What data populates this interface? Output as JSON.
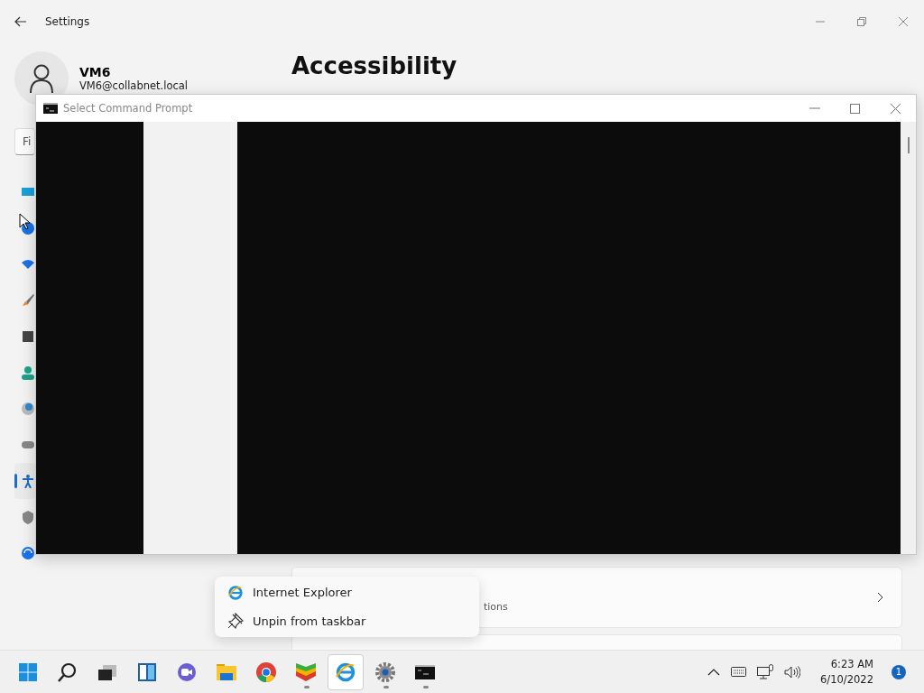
{
  "settings_window": {
    "title": "Settings",
    "user": {
      "name": "VM6",
      "email": "VM6@collabnet.local"
    },
    "search": {
      "placeholder": "Fi"
    },
    "sidebar": {
      "items": [
        {
          "kind": "display",
          "selected": false
        },
        {
          "kind": "bluetooth",
          "selected": false
        },
        {
          "kind": "wifi",
          "selected": false
        },
        {
          "kind": "brush",
          "selected": false
        },
        {
          "kind": "apps",
          "selected": false
        },
        {
          "kind": "person",
          "selected": false
        },
        {
          "kind": "clock",
          "selected": false
        },
        {
          "kind": "gamepad",
          "selected": false
        },
        {
          "kind": "accessibility",
          "selected": true
        },
        {
          "kind": "shield",
          "selected": false
        },
        {
          "kind": "update",
          "selected": false
        }
      ]
    },
    "page_title": "Accessibility",
    "cards": [
      {
        "subtitle": "tions"
      }
    ]
  },
  "command_prompt": {
    "title": "Select Command Prompt"
  },
  "context_menu": {
    "items": [
      {
        "kind": "app",
        "label": "Internet Explorer"
      },
      {
        "kind": "unpin",
        "label": "Unpin from taskbar"
      }
    ]
  },
  "taskbar": {
    "apps": [
      {
        "kind": "start",
        "running": false,
        "selected": false
      },
      {
        "kind": "search",
        "running": false,
        "selected": false
      },
      {
        "kind": "taskview",
        "running": false,
        "selected": false
      },
      {
        "kind": "widgets",
        "running": false,
        "selected": false
      },
      {
        "kind": "chat",
        "running": false,
        "selected": false
      },
      {
        "kind": "explorer",
        "running": false,
        "selected": false
      },
      {
        "kind": "chrome",
        "running": false,
        "selected": false
      },
      {
        "kind": "stack",
        "running": true,
        "selected": false
      },
      {
        "kind": "ie",
        "running": false,
        "selected": true
      },
      {
        "kind": "settings",
        "running": true,
        "selected": false
      },
      {
        "kind": "terminal",
        "running": true,
        "selected": false
      }
    ],
    "time": "6:23 AM",
    "date": "6/10/2022",
    "notifications": "1"
  }
}
